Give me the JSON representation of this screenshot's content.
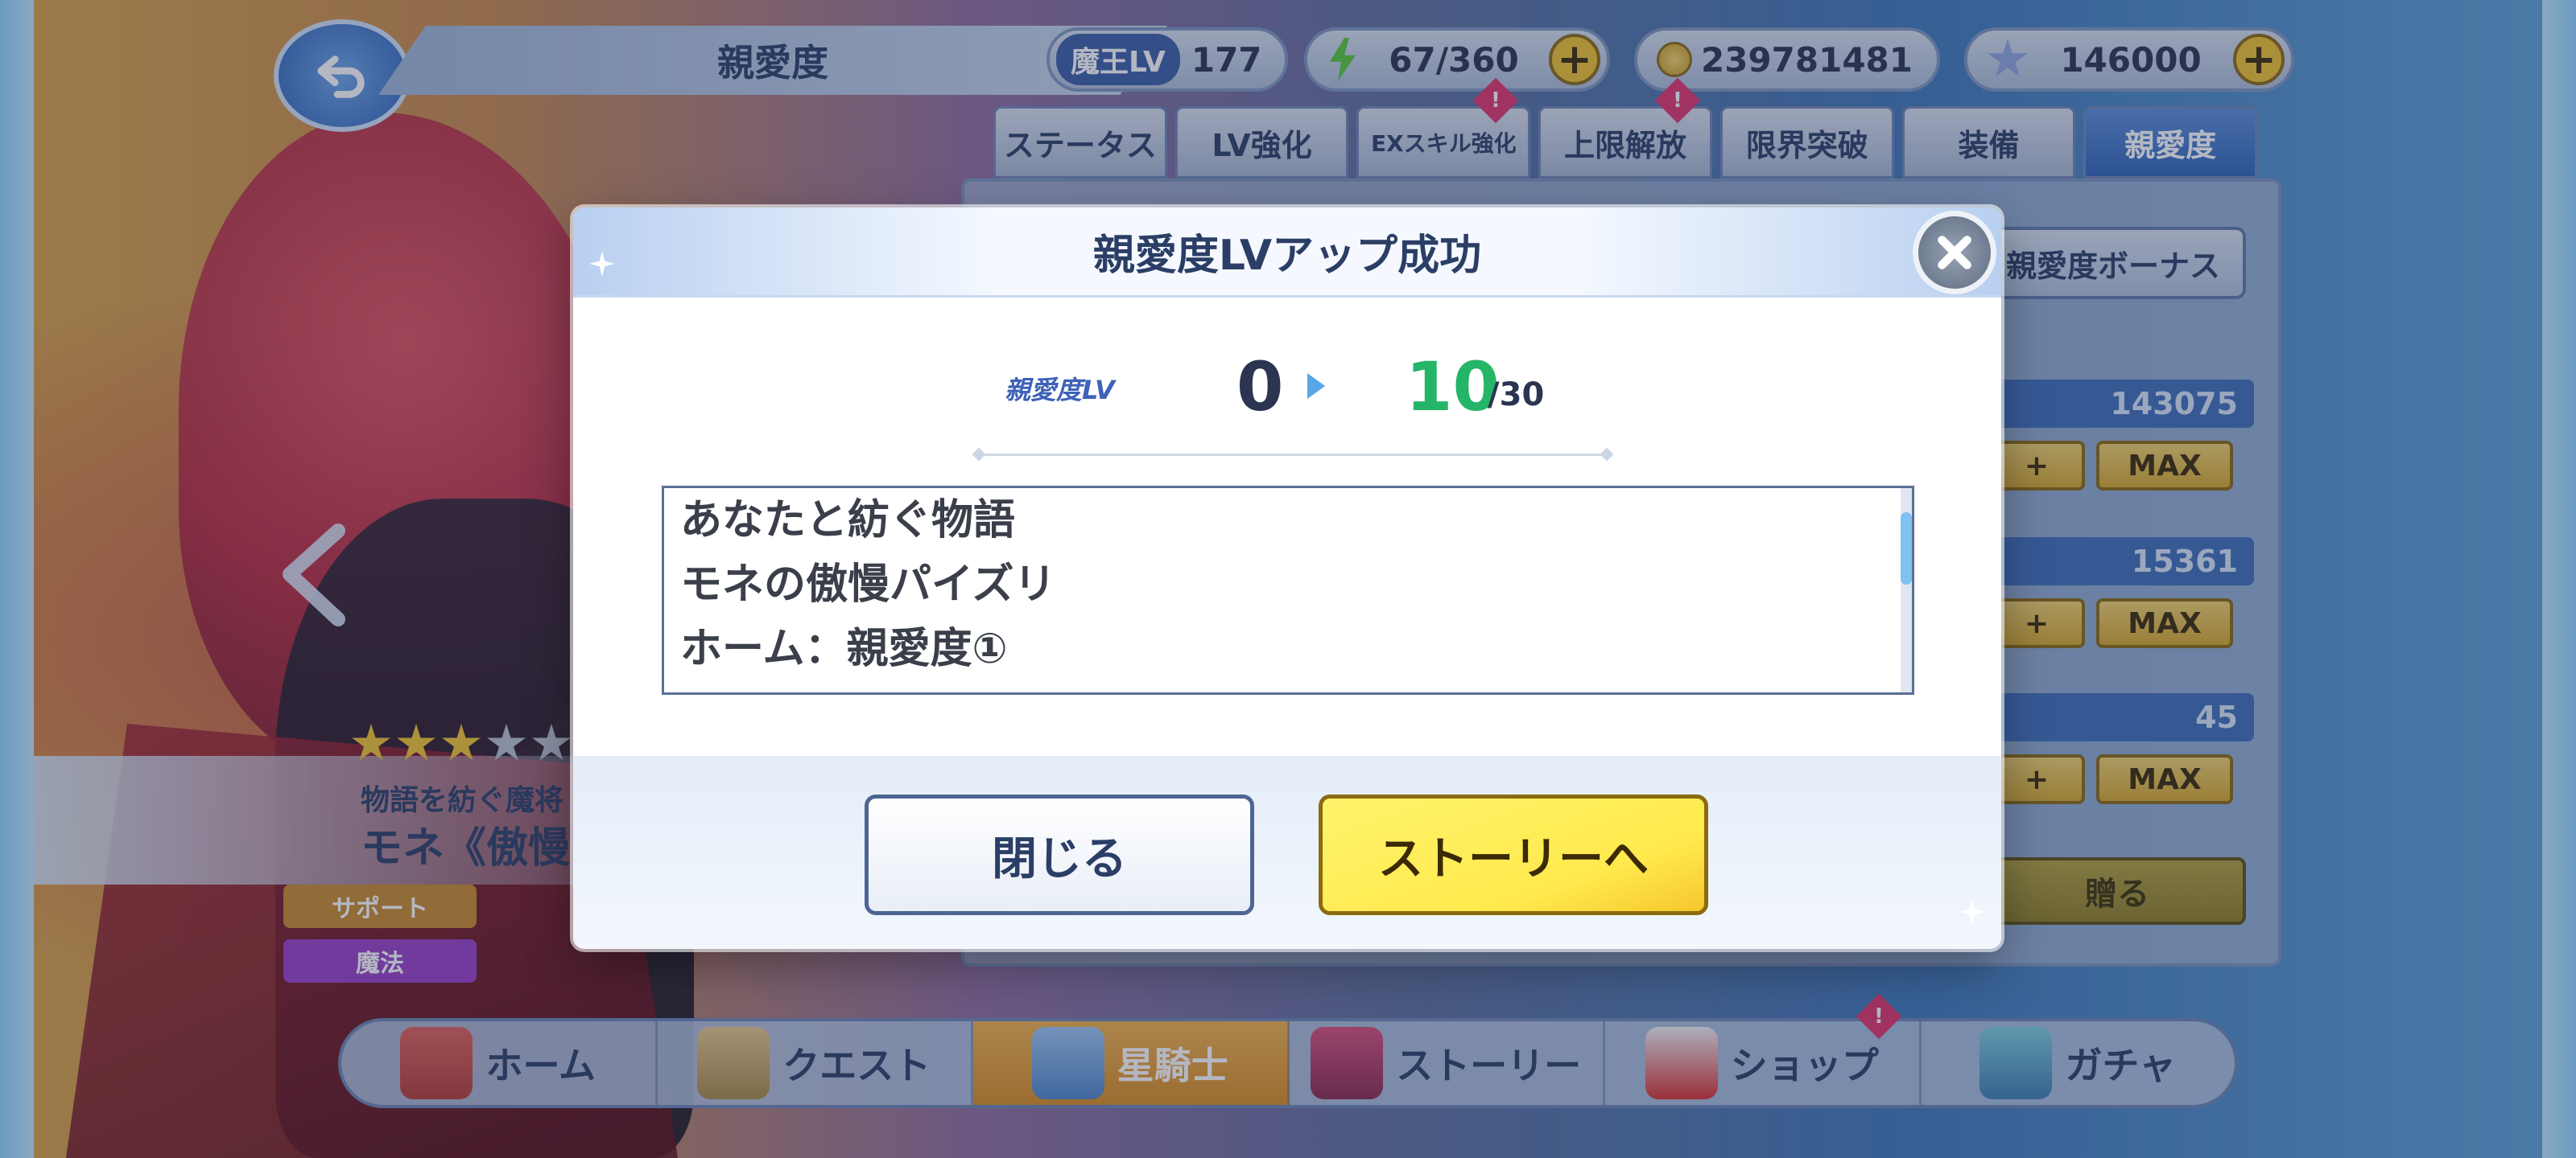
{
  "screen": {
    "title": "親愛度",
    "help_label": "?"
  },
  "resources": {
    "level_tag": "魔王LV",
    "level_value": "177",
    "stamina": "67/360",
    "gold": "239781481",
    "gems": "146000"
  },
  "tabs": [
    {
      "label": "ステータス"
    },
    {
      "label": "LV強化"
    },
    {
      "label": "EXスキル強化"
    },
    {
      "label": "上限解放"
    },
    {
      "label": "限界突破"
    },
    {
      "label": "装備"
    },
    {
      "label": "親愛度"
    }
  ],
  "tab_badge": "!",
  "side_panel": {
    "bonus_button": "親愛度ボーナス",
    "stats": [
      {
        "value": "143075",
        "plus": "+",
        "max": "MAX"
      },
      {
        "value": "15361",
        "plus": "+",
        "max": "MAX"
      },
      {
        "value": "45",
        "plus": "+",
        "max": "MAX"
      }
    ],
    "gift_button": "贈る"
  },
  "character": {
    "stars_total": 5,
    "stars_filled": 3,
    "subtitle": "物語を紡ぐ魔将",
    "name": "モネ《傲慢",
    "roles": [
      {
        "label": "サポート",
        "color": "#c98a2b"
      },
      {
        "label": "魔法",
        "color": "#9a3fc7"
      }
    ]
  },
  "bottom_nav": [
    {
      "label": "ホーム",
      "icon": "home-icon",
      "active": false
    },
    {
      "label": "クエスト",
      "icon": "quest-icon",
      "active": false
    },
    {
      "label": "星騎士",
      "icon": "knight-icon",
      "active": true
    },
    {
      "label": "ストーリー",
      "icon": "story-icon",
      "active": false
    },
    {
      "label": "ショップ",
      "icon": "shop-icon",
      "active": false,
      "badge": "!"
    },
    {
      "label": "ガチャ",
      "icon": "gacha-icon",
      "active": false
    }
  ],
  "modal": {
    "title": "親愛度LVアップ成功",
    "lv_label": "親愛度LV",
    "lv_from": "0",
    "lv_to": "10",
    "lv_max": "/30",
    "unlocks": [
      "あなたと紡ぐ物語",
      "モネの傲慢パイズリ",
      "ホーム：親愛度①"
    ],
    "close_button": "閉じる",
    "story_button": "ストーリーへ"
  },
  "colors": {
    "accent_blue": "#2f64b8",
    "level_green": "#25b569",
    "story_yellow": "#ffe94d"
  }
}
